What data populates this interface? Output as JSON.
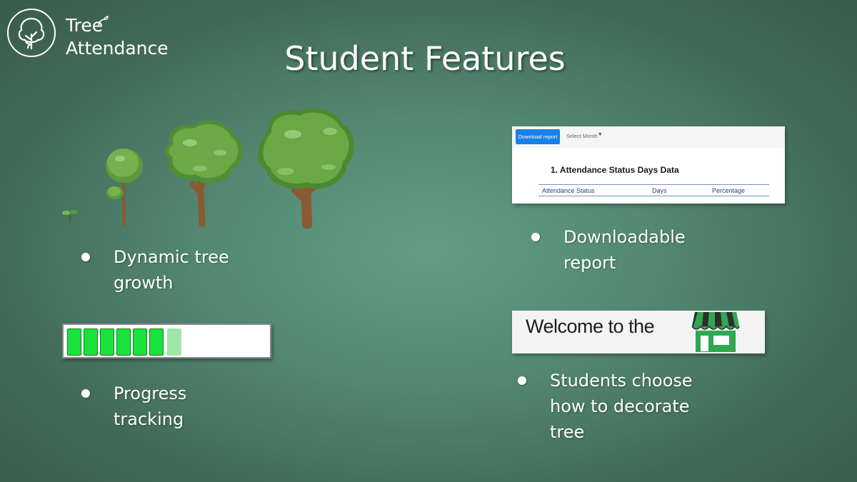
{
  "logo": {
    "line1": "Tree",
    "line2": "Attendance"
  },
  "slide": {
    "title": "Student Features"
  },
  "features": {
    "growth": {
      "line1": "Dynamic tree",
      "line2": "growth"
    },
    "progress": {
      "line1": "Progress",
      "line2": "tracking",
      "filled_segments": 6,
      "partial_segments": 1
    },
    "report": {
      "line1": "Downloadable",
      "line2": "report"
    },
    "decorate": {
      "line1": "Students choose",
      "line2": "how to decorate",
      "line3": "tree"
    }
  },
  "report_preview": {
    "download_button": "Download report",
    "select_month": "Select Month",
    "heading": "1.  Attendance Status Days Data",
    "columns": [
      "Attendance Status",
      "Days",
      "Percentage"
    ]
  },
  "shop_preview": {
    "text": "Welcome to the"
  },
  "icons": {
    "logo": "tree-logo-icon",
    "shop": "shop-storefront-icon",
    "bullet": "bullet-dot"
  },
  "colors": {
    "background": "#5a917a",
    "progress_fill": "#19e33b",
    "progress_partial": "#9ee6a6",
    "button": "#1a7fe6",
    "shop_green": "#2fa84f"
  }
}
